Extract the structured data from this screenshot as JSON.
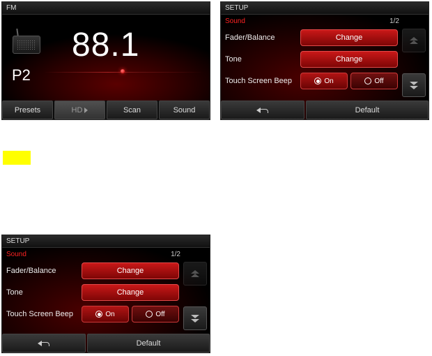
{
  "radio": {
    "title": "FM",
    "preset": "P2",
    "frequency": "88.1",
    "buttons": {
      "presets": "Presets",
      "hd": "HD",
      "scan": "Scan",
      "sound": "Sound"
    }
  },
  "setup": {
    "title": "SETUP",
    "section": "Sound",
    "page": "1/2",
    "rows": {
      "fader": {
        "label": "Fader/Balance",
        "button": "Change"
      },
      "tone": {
        "label": "Tone",
        "button": "Change"
      },
      "beep": {
        "label": "Touch Screen Beep",
        "on": "On",
        "off": "Off"
      }
    },
    "bottom": {
      "default": "Default"
    }
  }
}
